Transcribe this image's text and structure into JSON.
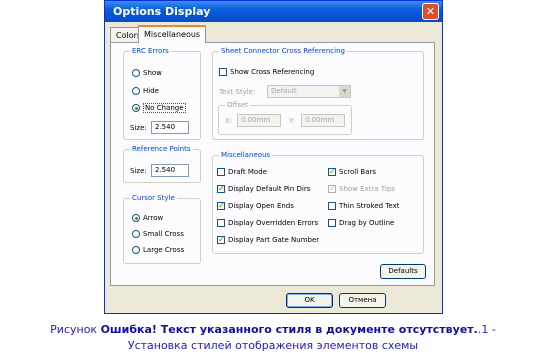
{
  "dialog": {
    "title": "Options Display",
    "close_glyph": "✕",
    "tabs": [
      "Colors",
      "Miscellaneous"
    ],
    "erc_errors": {
      "label": "ERC Errors",
      "options": [
        "Show",
        "Hide",
        "No Change"
      ],
      "selected": "No Change",
      "size_label": "Size:",
      "size_value": "2.540"
    },
    "reference_points": {
      "label": "Reference Points",
      "size_label": "Size:",
      "size_value": "2.540"
    },
    "cursor_style": {
      "label": "Cursor Style",
      "options": [
        "Arrow",
        "Small Cross",
        "Large Cross"
      ],
      "selected": "Arrow"
    },
    "sheet_connector": {
      "label": "Sheet Connector Cross Referencing",
      "show_label": "Show Cross Referencing",
      "show_checked": false,
      "text_style_label": "Text Style:",
      "text_style_value": "Default",
      "offset_label": "Offset",
      "x_label": "X:",
      "x_value": "0.00mm",
      "y_label": "Y:",
      "y_value": "0.00mm"
    },
    "miscellaneous": {
      "label": "Miscellaneous",
      "items": [
        {
          "label": "Draft Mode",
          "checked": false,
          "enabled": true
        },
        {
          "label": "Scroll Bars",
          "checked": true,
          "enabled": true
        },
        {
          "label": "Display Default Pin Dirs",
          "checked": true,
          "enabled": true
        },
        {
          "label": "Show Extra Tips",
          "checked": true,
          "enabled": false
        },
        {
          "label": "Display Open Ends",
          "checked": true,
          "enabled": true
        },
        {
          "label": "Thin Stroked Text",
          "checked": false,
          "enabled": true
        },
        {
          "label": "Display Overridden Errors",
          "checked": false,
          "enabled": true
        },
        {
          "label": "Drag by Outline",
          "checked": false,
          "enabled": true
        },
        {
          "label": "Display Part Gate Number",
          "checked": true,
          "enabled": true
        }
      ]
    },
    "buttons": {
      "defaults": "Defaults",
      "ok": "OK",
      "cancel": "Отмена"
    }
  },
  "caption": {
    "prefix": "Рисунок ",
    "error": "Ошибка! Текст указанного стиля в документе отсутствует.",
    "suffix": ".1 -",
    "line2": "Установка стилей отображения элементов схемы"
  }
}
